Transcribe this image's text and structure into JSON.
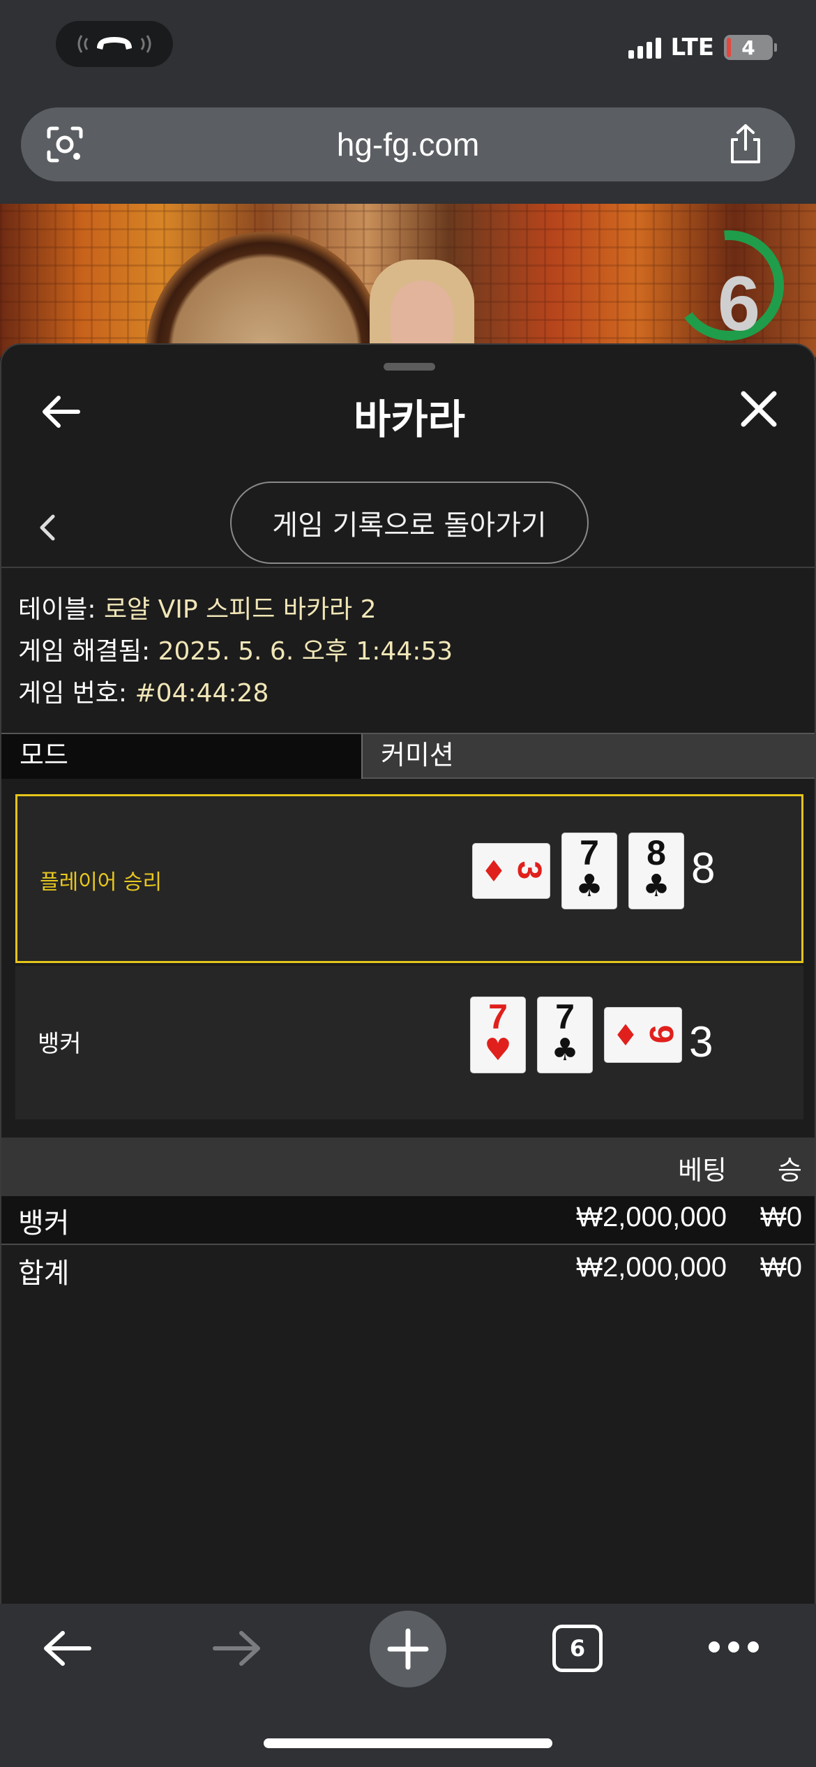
{
  "status_bar": {
    "network": "LTE",
    "battery": "4",
    "signal_bars": 4
  },
  "browser": {
    "url": "hg-fg.com",
    "tab_count": "6"
  },
  "video": {
    "timer": "6"
  },
  "sheet": {
    "title": "바카라",
    "history_button": "게임 기록으로 돌아가기",
    "info": {
      "table_label": "테이블: ",
      "table_value": "로얄 VIP 스피드 바카라 2",
      "resolved_label": "게임 해결됨: ",
      "resolved_value": "2025. 5. 6. 오후 1:44:53",
      "number_label": "게임 번호: ",
      "number_value": "#04:44:28"
    },
    "mode_tab": "모드",
    "commission_tab": "커미션",
    "results": {
      "player": {
        "label": "플레이어 승리",
        "cards": [
          {
            "rank": "3",
            "suit": "♦",
            "color": "#e0201c",
            "orientation": "sideways"
          },
          {
            "rank": "7",
            "suit": "♣",
            "color": "#111111",
            "orientation": "upright"
          },
          {
            "rank": "8",
            "suit": "♣",
            "color": "#111111",
            "orientation": "upright"
          }
        ],
        "score": "8",
        "highlight_color": "#e5c51a"
      },
      "banker": {
        "label": "뱅커",
        "cards": [
          {
            "rank": "7",
            "suit": "♥",
            "color": "#e0201c",
            "orientation": "upright"
          },
          {
            "rank": "7",
            "suit": "♣",
            "color": "#111111",
            "orientation": "upright"
          },
          {
            "rank": "9",
            "suit": "♦",
            "color": "#e0201c",
            "orientation": "sideways"
          }
        ],
        "score": "3"
      }
    },
    "bets": {
      "header_bet": "베팅",
      "header_win": "승",
      "rows": [
        {
          "label": "뱅커",
          "amount": "₩2,000,000",
          "win": "₩0"
        }
      ],
      "total": {
        "label": "합계",
        "amount": "₩2,000,000",
        "win": "₩0"
      }
    }
  },
  "icons": {
    "status": [
      "call-icon",
      "signal-icon",
      "battery-icon"
    ],
    "url_bar": [
      "google-lens-icon",
      "share-icon"
    ],
    "sheet": [
      "back-arrow-icon",
      "close-icon",
      "chevron-left-icon"
    ],
    "toolbar": [
      "back-icon",
      "forward-icon",
      "plus-icon",
      "tabs-icon",
      "more-icon"
    ]
  }
}
